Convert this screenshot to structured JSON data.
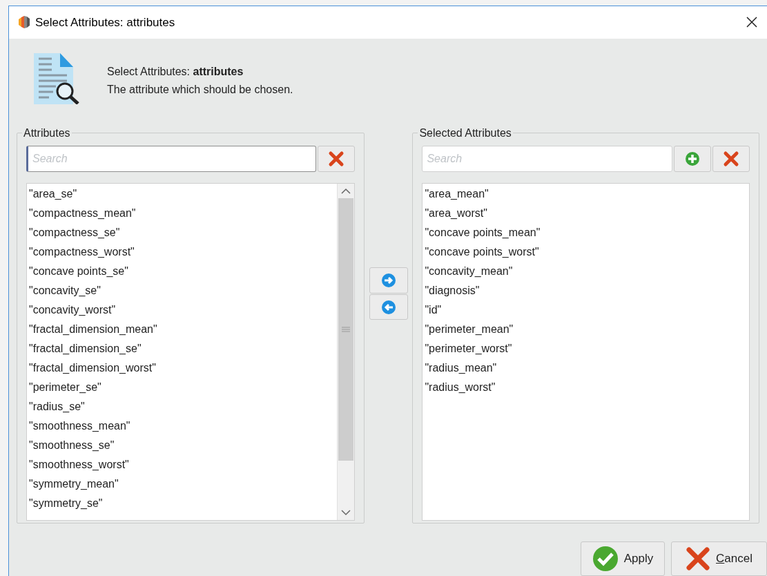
{
  "window": {
    "title": "Select Attributes: attributes"
  },
  "header": {
    "title": "Select Attributes: **attributes**",
    "description": "The attribute which should be chosen."
  },
  "attributes": {
    "legend": "Attributes",
    "search": {
      "placeholder": "Search",
      "focused": true
    },
    "items": [
      "\"area_se\"",
      "\"compactness_mean\"",
      "\"compactness_se\"",
      "\"compactness_worst\"",
      "\"concave points_se\"",
      "\"concavity_se\"",
      "\"concavity_worst\"",
      "\"fractal_dimension_mean\"",
      "\"fractal_dimension_se\"",
      "\"fractal_dimension_worst\"",
      "\"perimeter_se\"",
      "\"radius_se\"",
      "\"smoothness_mean\"",
      "\"smoothness_se\"",
      "\"smoothness_worst\"",
      "\"symmetry_mean\"",
      "\"symmetry_se\""
    ]
  },
  "selected_attributes": {
    "legend": "Selected Attributes",
    "search": {
      "placeholder": "Search",
      "focused": false
    },
    "items": [
      "\"area_mean\"",
      "\"area_worst\"",
      "\"concave points_mean\"",
      "\"concave points_worst\"",
      "\"concavity_mean\"",
      "\"diagnosis\"",
      "\"id\"",
      "\"perimeter_mean\"",
      "\"perimeter_worst\"",
      "\"radius_mean\"",
      "\"radius_worst\""
    ]
  },
  "buttons": [
    {
      "kind": "apply",
      "label": "Apply",
      "mnemonic": false
    },
    {
      "kind": "cancel",
      "label": "Cancel",
      "mnemonic": true
    }
  ]
}
